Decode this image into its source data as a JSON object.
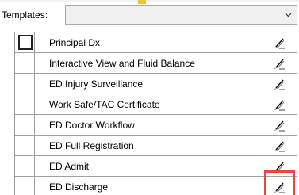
{
  "templates": {
    "label": "Templates:",
    "value": ""
  },
  "list": {
    "rows": [
      {
        "label": "Principal Dx",
        "checked": false
      },
      {
        "label": "Interactive View and Fluid Balance"
      },
      {
        "label": "ED Injury Surveillance"
      },
      {
        "label": "Work Safe/TAC Certificate"
      },
      {
        "label": "ED Doctor Workflow"
      },
      {
        "label": "ED Full Registration"
      },
      {
        "label": "ED Admit"
      },
      {
        "label": "ED Discharge"
      }
    ],
    "row_icon": "edit-pencil-icon"
  },
  "colors": {
    "highlight": "#e84545",
    "marker": "#f2c232"
  }
}
